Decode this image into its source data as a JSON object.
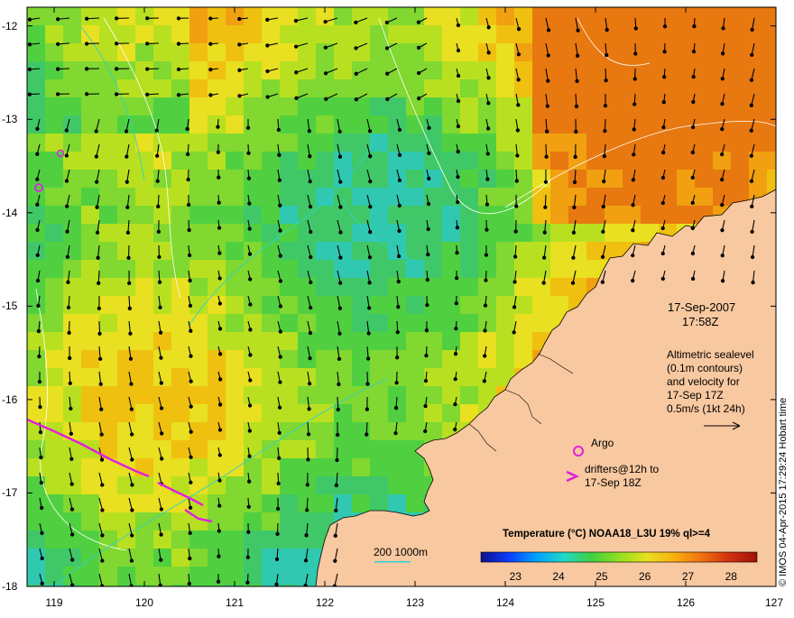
{
  "map": {
    "x_ticks": [
      "119",
      "120",
      "121",
      "122",
      "123",
      "124",
      "125",
      "126",
      "127"
    ],
    "y_ticks": [
      "-12",
      "-13",
      "-14",
      "-15",
      "-16",
      "-17",
      "-18"
    ],
    "lon_range": [
      118.7,
      127.0
    ],
    "lat_range": [
      -18.0,
      -11.8
    ]
  },
  "annotations": {
    "date": "17-Sep-2007",
    "time": "17:58Z",
    "altimetry": [
      "Altimetric sealevel",
      "(0.1m contours)",
      "and velocity for",
      "17-Sep 17Z",
      "0.5m/s (1kt 24h)"
    ],
    "argo_label": "Argo",
    "drifters": [
      "drifters@12h to",
      "17-Sep 18Z"
    ],
    "depth_legend": "200  1000m",
    "credit": "© IMOS 04-Apr-2015 17:29:24 Hobart time"
  },
  "colorbar": {
    "title": "Temperature (°C) NOAA18_L3U 19% ql>=4",
    "labels": [
      "23",
      "24",
      "25",
      "26",
      "27",
      "28"
    ],
    "colors": [
      "#10108a",
      "#0a3cff",
      "#00a0ff",
      "#20d8c8",
      "#40d040",
      "#90e020",
      "#e8e020",
      "#f8b010",
      "#f07010",
      "#d03010",
      "#a01008"
    ]
  },
  "colors": {
    "land": "#f8c8a0",
    "argo": "#e020e0",
    "contour": "#ffffff",
    "bathy": "#30d0d0"
  }
}
